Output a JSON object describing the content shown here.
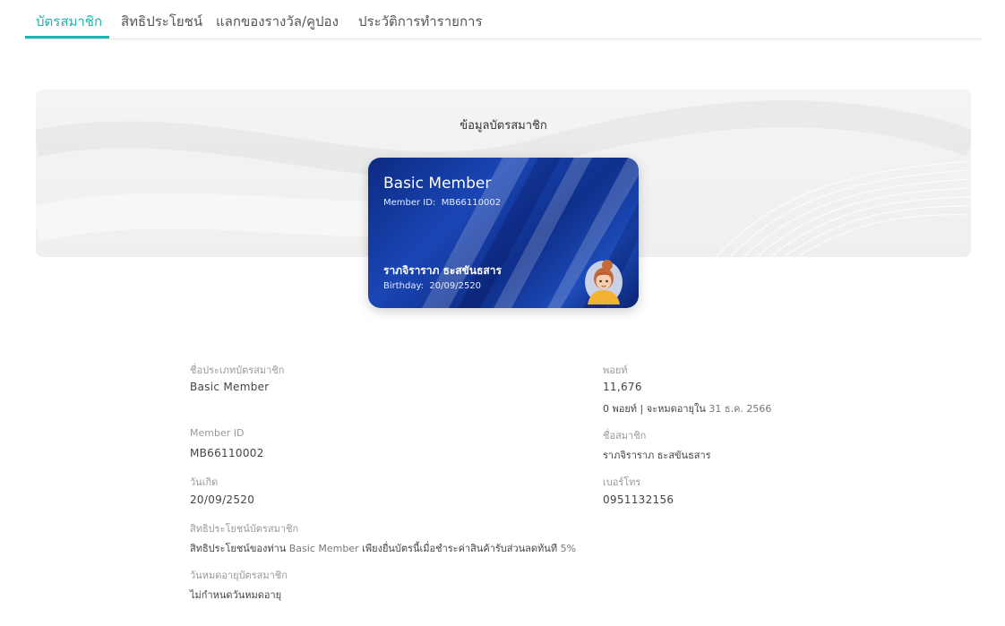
{
  "tabs": [
    {
      "label": "บัตรสมาชิก",
      "active": true
    },
    {
      "label": "สิทธิประโยชน์",
      "active": false
    },
    {
      "label": "แลกของรางวัล/คูปอง",
      "active": false
    },
    {
      "label": "ประวัติการทำรายการ",
      "active": false
    }
  ],
  "accent_color": "#1fb5b0",
  "banner": {
    "title": "ข้อมูลบัตรสมาชิก"
  },
  "card": {
    "tier": "Basic Member",
    "member_id_label": "Member ID:",
    "member_id": "MB66110002",
    "name": "ราภจิราราภ ธะสขันธสาร",
    "birthday_label": "Birthday:",
    "birthday": "20/09/2520",
    "avatar_icon": "member-avatar-icon"
  },
  "fields": {
    "type_label": "ชื่อประเภทบัตรสมาชิก",
    "type_value": "Basic Member",
    "points_label": "พอยท์",
    "points_value": "11,676",
    "points_expiry_count": "0",
    "points_expiry_text": "พอยท์ | จะหมดอายุใน",
    "points_expiry_date": "31 ธ.ค. 2566",
    "member_id_label": "Member ID",
    "member_id_value": "MB66110002",
    "member_name_label": "ชื่อสมาชิก",
    "member_name_value": "ราภจิราราภ ธะสขันธสาร",
    "birthday_label": "วันเกิด",
    "birthday_value": "20/09/2520",
    "phone_label": "เบอร์โทร",
    "phone_value": "0951132156",
    "benefit_label": "สิทธิประโยชน์บัตรสมาชิก",
    "benefit_prefix": "สิทธิประโยชน์ของท่าน",
    "benefit_tier": "Basic Member",
    "benefit_middle": "เพียงยื่นบัตรนี้เมื่อชำระค่าสินค้ารับส่วนลดทันที",
    "benefit_discount": "5%",
    "expiry_label": "วันหมดอายุบัตรสมาชิก",
    "expiry_value": "ไม่กำหนดวันหมดอายุ"
  }
}
